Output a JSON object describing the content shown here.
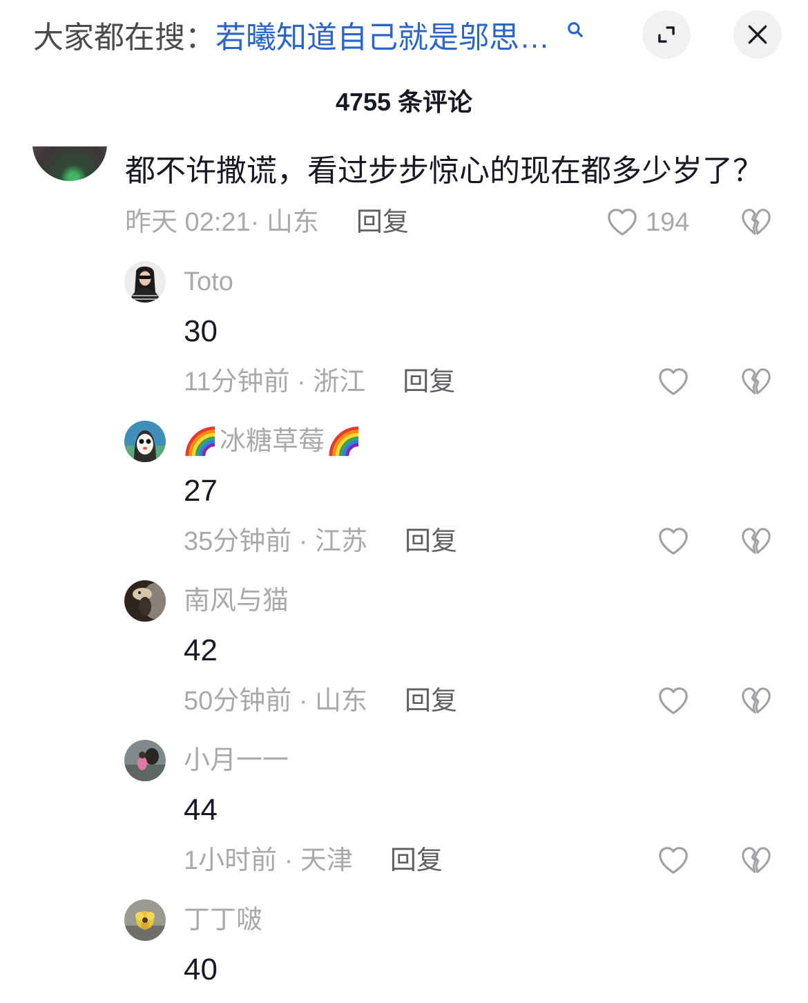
{
  "top_bar": {
    "search_prefix": "大家都在搜：",
    "search_query": "若曦知道自己就是邬思…",
    "icons": {
      "search": "search-icon",
      "expand": "expand-icon",
      "close": "close-icon"
    }
  },
  "header": {
    "title": "4755 条评论"
  },
  "main_comment": {
    "text": "都不许撒谎，看过步步惊心的现在都多少岁了？",
    "meta": "昨天 02:21· 山东",
    "reply_label": "回复",
    "like_count": "194",
    "icons": {
      "like": "heart-icon",
      "dislike": "broken-heart-icon"
    }
  },
  "replies": [
    {
      "name": "Toto",
      "text": "30",
      "meta": "11分钟前 · 浙江",
      "reply_label": "回复"
    },
    {
      "name": "冰糖草莓",
      "name_decoration": "rainbow-icon",
      "text": "27",
      "meta": "35分钟前 · 江苏",
      "reply_label": "回复"
    },
    {
      "name": "南风与猫",
      "text": "42",
      "meta": "50分钟前 · 山东",
      "reply_label": "回复"
    },
    {
      "name": "小月一一",
      "text": "44",
      "meta": "1小时前 · 天津",
      "reply_label": "回复"
    },
    {
      "name": "丁丁啵",
      "text": "40"
    }
  ],
  "colors": {
    "background": "#ffffff",
    "primary_text": "#161823",
    "secondary_text": "#a8a8ad",
    "reply_label": "#5e5e63",
    "link_blue": "#2b65c9",
    "icon_gray": "#a0a0a5",
    "button_bg": "#f1f1f2"
  }
}
